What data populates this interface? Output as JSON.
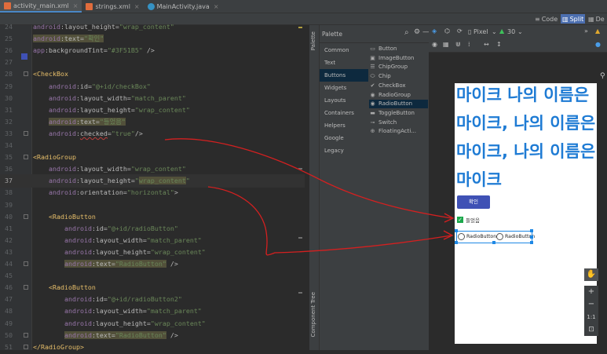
{
  "tabs": [
    {
      "label": "activity_main.xml",
      "color": "#e06c3c",
      "active": true
    },
    {
      "label": "strings.xml",
      "color": "#e06c3c",
      "active": false
    },
    {
      "label": "MainActivity.java",
      "color": "#3592c4",
      "active": false
    }
  ],
  "view_modes": {
    "code": "Code",
    "split": "Split",
    "design": "De"
  },
  "code_lines": [
    {
      "n": "24",
      "html": "<span class='ns'>android</span>:layout_height=<span class='val'>\"wrap_content\"</span>"
    },
    {
      "n": "25",
      "html": "<span class='hl'><span class='ns'>android</span>:text=<span class='val'>\"확인\"</span></span>"
    },
    {
      "n": "26",
      "html": "<span class='ns'>app</span>:backgroundTint=<span class='val'>\"#3F51B5\"</span> /&gt;"
    },
    {
      "n": "27",
      "html": ""
    },
    {
      "n": "28",
      "html": "<span class='tag'>&lt;CheckBox</span>"
    },
    {
      "n": "29",
      "html": "    <span class='ns'>android</span>:id=<span class='val'>\"@+id/checkBox\"</span>"
    },
    {
      "n": "30",
      "html": "    <span class='ns'>android</span>:layout_width=<span class='val'>\"match_parent\"</span>"
    },
    {
      "n": "31",
      "html": "    <span class='ns'>android</span>:layout_height=<span class='val'>\"wrap_content\"</span>"
    },
    {
      "n": "32",
      "html": "    <span class='hl'><span class='ns'>android</span>:text=<span class='val'>\"들었음\"</span></span>"
    },
    {
      "n": "33",
      "html": "    <span class='ns'>android</span>:<span class='err'>checked</span>=<span class='val'>\"true\"</span>/&gt;"
    },
    {
      "n": "34",
      "html": ""
    },
    {
      "n": "35",
      "html": "<span class='tag'>&lt;RadioGroup</span>"
    },
    {
      "n": "36",
      "html": "    <span class='ns'>android</span>:layout_width=<span class='val'>\"wrap_content\"</span>"
    },
    {
      "n": "37",
      "html": "    <span class='ns'>android</span>:layout_height=<span class='val'>\"<span class='hl'>wrap_content</span>\"</span>"
    },
    {
      "n": "38",
      "html": "    <span class='ns'>android</span>:orientation=<span class='val'>\"horizontal\"</span>&gt;"
    },
    {
      "n": "39",
      "html": ""
    },
    {
      "n": "40",
      "html": "    <span class='tag'>&lt;RadioButton</span>"
    },
    {
      "n": "41",
      "html": "        <span class='ns'>android</span>:id=<span class='val'>\"@+id/radioButton\"</span>"
    },
    {
      "n": "42",
      "html": "        <span class='ns'>android</span>:layout_width=<span class='val'>\"match_parent\"</span>"
    },
    {
      "n": "43",
      "html": "        <span class='ns'>android</span>:layout_height=<span class='val'>\"wrap_content\"</span>"
    },
    {
      "n": "44",
      "html": "        <span class='hl'><span class='ns'>android</span>:text=<span class='val'>\"RadioButton\"</span></span> /&gt;"
    },
    {
      "n": "45",
      "html": ""
    },
    {
      "n": "46",
      "html": "    <span class='tag'>&lt;RadioButton</span>"
    },
    {
      "n": "47",
      "html": "        <span class='ns'>android</span>:id=<span class='val'>\"@+id/radioButton2\"</span>"
    },
    {
      "n": "48",
      "html": "        <span class='ns'>android</span>:layout_width=<span class='val'>\"match_parent\"</span>"
    },
    {
      "n": "49",
      "html": "        <span class='ns'>android</span>:layout_height=<span class='val'>\"wrap_content\"</span>"
    },
    {
      "n": "50",
      "html": "        <span class='hl'><span class='ns'>android</span>:text=<span class='val'>\"RadioButton\"</span></span> /&gt;"
    },
    {
      "n": "51",
      "html": "<span class='tag'>&lt;/RadioGroup&gt;</span>"
    }
  ],
  "palette": {
    "title": "Palette",
    "side_tab": "Palette",
    "side_tab2": "Component Tree",
    "categories": [
      "Common",
      "Text",
      "Buttons",
      "Widgets",
      "Layouts",
      "Containers",
      "Helpers",
      "Google",
      "Legacy"
    ],
    "selected_category": "Buttons",
    "items": [
      {
        "label": "Button",
        "icon": "▭"
      },
      {
        "label": "ImageButton",
        "icon": "▣"
      },
      {
        "label": "ChipGroup",
        "icon": "☰"
      },
      {
        "label": "Chip",
        "icon": "⬭"
      },
      {
        "label": "CheckBox",
        "icon": "✔"
      },
      {
        "label": "RadioGroup",
        "icon": "◉"
      },
      {
        "label": "RadioButton",
        "icon": "◉"
      },
      {
        "label": "ToggleButton",
        "icon": "▬"
      },
      {
        "label": "Switch",
        "icon": "⊸"
      },
      {
        "label": "FloatingActi...",
        "icon": "⊕"
      }
    ],
    "selected_item": "RadioButton"
  },
  "design_toolbar": {
    "device": "Pixel",
    "api": "30"
  },
  "preview": {
    "lines": [
      "마이크 나의 이름은",
      "마이크, 나의 이름은",
      "마이크, 나의 이름은",
      "마이크"
    ],
    "button_label": "확인",
    "button_color": "#3F51B5",
    "checkbox_label": "들었음",
    "checkbox_checked": true,
    "radio_labels": [
      "RadioButton",
      "RadioButton"
    ]
  },
  "zoom_controls": {
    "fit": "1:1"
  }
}
